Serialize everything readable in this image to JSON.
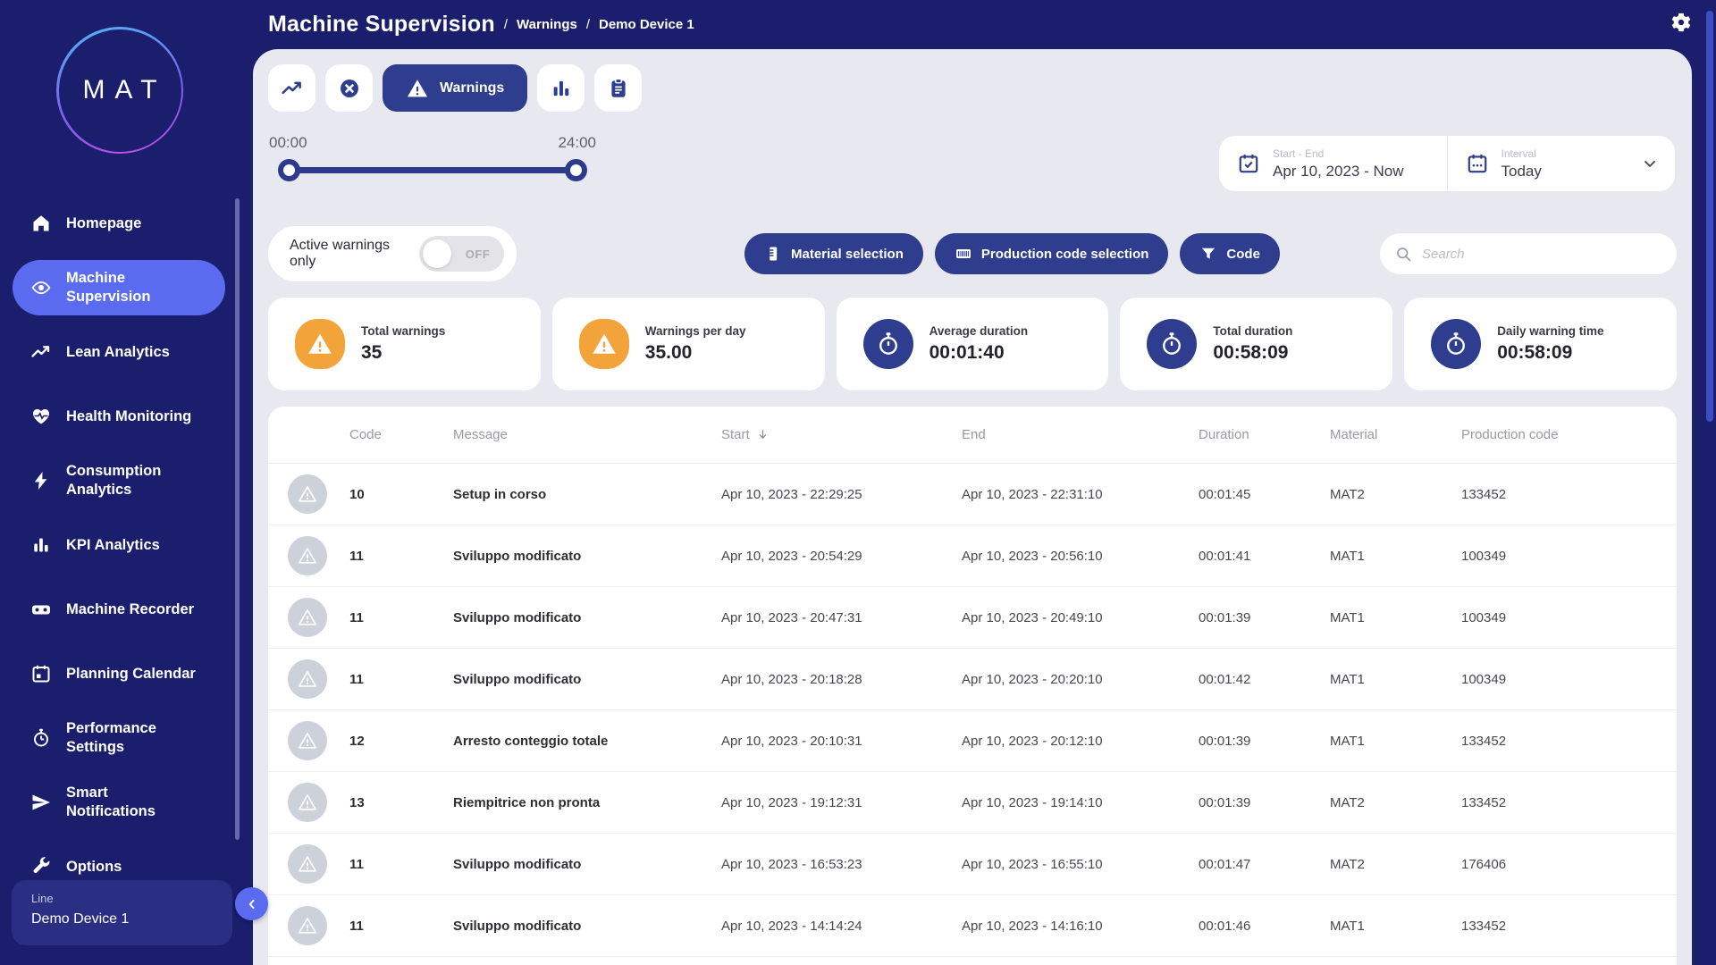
{
  "header": {
    "title": "Machine Supervision",
    "separator": "/",
    "breadcrumb": [
      "Warnings",
      "Demo Device 1"
    ]
  },
  "sidebar": {
    "logo": "MAT",
    "items": [
      {
        "label": "Homepage",
        "icon": "home-icon",
        "active": false
      },
      {
        "label": "Machine Supervision",
        "icon": "eye-icon",
        "active": true
      },
      {
        "label": "Lean Analytics",
        "icon": "trend-icon",
        "active": false
      },
      {
        "label": "Health Monitoring",
        "icon": "heart-pulse-icon",
        "active": false
      },
      {
        "label": "Consumption Analytics",
        "icon": "bolt-icon",
        "active": false
      },
      {
        "label": "KPI Analytics",
        "icon": "bar-chart-icon",
        "active": false
      },
      {
        "label": "Machine Recorder",
        "icon": "recorder-icon",
        "active": false
      },
      {
        "label": "Planning Calendar",
        "icon": "calendar-icon",
        "active": false
      },
      {
        "label": "Performance Settings",
        "icon": "stopwatch-icon",
        "active": false
      },
      {
        "label": "Smart Notifications",
        "icon": "send-icon",
        "active": false
      },
      {
        "label": "Options",
        "icon": "wrench-icon",
        "active": false
      }
    ],
    "device_card": {
      "label": "Line",
      "value": "Demo Device 1"
    }
  },
  "toolbar": {
    "tabs": [
      {
        "icon": "trend-icon",
        "active": false
      },
      {
        "icon": "stop-circle-icon",
        "active": false
      },
      {
        "icon": "warning-icon",
        "label": "Warnings",
        "active": true
      },
      {
        "icon": "bar-chart-icon",
        "active": false
      },
      {
        "icon": "report-icon",
        "active": false
      }
    ]
  },
  "time_slider": {
    "start_label": "00:00",
    "end_label": "24:00"
  },
  "date_filter": {
    "range_label": "Start - End",
    "range_value": "Apr 10, 2023 - Now",
    "interval_label": "Interval",
    "interval_value": "Today"
  },
  "filters": {
    "active_warnings_label": "Active warnings only",
    "toggle_state": "OFF",
    "material_button": "Material selection",
    "production_code_button": "Production code selection",
    "code_button": "Code",
    "search_placeholder": "Search"
  },
  "stats": [
    {
      "label": "Total warnings",
      "value": "35",
      "icon": "warning-icon",
      "color": "#F2A33A"
    },
    {
      "label": "Warnings per day",
      "value": "35.00",
      "icon": "warning-icon",
      "color": "#F2A33A"
    },
    {
      "label": "Average duration",
      "value": "00:01:40",
      "icon": "stopwatch-icon",
      "color": "#2E3D8D"
    },
    {
      "label": "Total duration",
      "value": "00:58:09",
      "icon": "stopwatch-icon",
      "color": "#2E3D8D"
    },
    {
      "label": "Daily warning time",
      "value": "00:58:09",
      "icon": "stopwatch-icon",
      "color": "#2E3D8D"
    }
  ],
  "table": {
    "columns": [
      "Code",
      "Message",
      "Start",
      "End",
      "Duration",
      "Material",
      "Production code"
    ],
    "sorted_column": "Start",
    "sort_direction": "desc",
    "rows": [
      {
        "code": "10",
        "message": "Setup in corso",
        "start": "Apr 10, 2023 - 22:29:25",
        "end": "Apr 10, 2023 - 22:31:10",
        "duration": "00:01:45",
        "material": "MAT2",
        "production_code": "133452"
      },
      {
        "code": "11",
        "message": "Sviluppo modificato",
        "start": "Apr 10, 2023 - 20:54:29",
        "end": "Apr 10, 2023 - 20:56:10",
        "duration": "00:01:41",
        "material": "MAT1",
        "production_code": "100349"
      },
      {
        "code": "11",
        "message": "Sviluppo modificato",
        "start": "Apr 10, 2023 - 20:47:31",
        "end": "Apr 10, 2023 - 20:49:10",
        "duration": "00:01:39",
        "material": "MAT1",
        "production_code": "100349"
      },
      {
        "code": "11",
        "message": "Sviluppo modificato",
        "start": "Apr 10, 2023 - 20:18:28",
        "end": "Apr 10, 2023 - 20:20:10",
        "duration": "00:01:42",
        "material": "MAT1",
        "production_code": "100349"
      },
      {
        "code": "12",
        "message": "Arresto conteggio totale",
        "start": "Apr 10, 2023 - 20:10:31",
        "end": "Apr 10, 2023 - 20:12:10",
        "duration": "00:01:39",
        "material": "MAT1",
        "production_code": "133452"
      },
      {
        "code": "13",
        "message": "Riempitrice non pronta",
        "start": "Apr 10, 2023 - 19:12:31",
        "end": "Apr 10, 2023 - 19:14:10",
        "duration": "00:01:39",
        "material": "MAT2",
        "production_code": "133452"
      },
      {
        "code": "11",
        "message": "Sviluppo modificato",
        "start": "Apr 10, 2023 - 16:53:23",
        "end": "Apr 10, 2023 - 16:55:10",
        "duration": "00:01:47",
        "material": "MAT2",
        "production_code": "176406"
      },
      {
        "code": "11",
        "message": "Sviluppo modificato",
        "start": "Apr 10, 2023 - 14:14:24",
        "end": "Apr 10, 2023 - 14:16:10",
        "duration": "00:01:46",
        "material": "MAT1",
        "production_code": "133452"
      }
    ]
  },
  "colors": {
    "navy": "#1A1E6D",
    "accent_blue": "#2E3D8D",
    "active_item_blue": "#5A6BEF",
    "warning_orange": "#F2A33A",
    "panel_background": "#E8E8F1"
  }
}
